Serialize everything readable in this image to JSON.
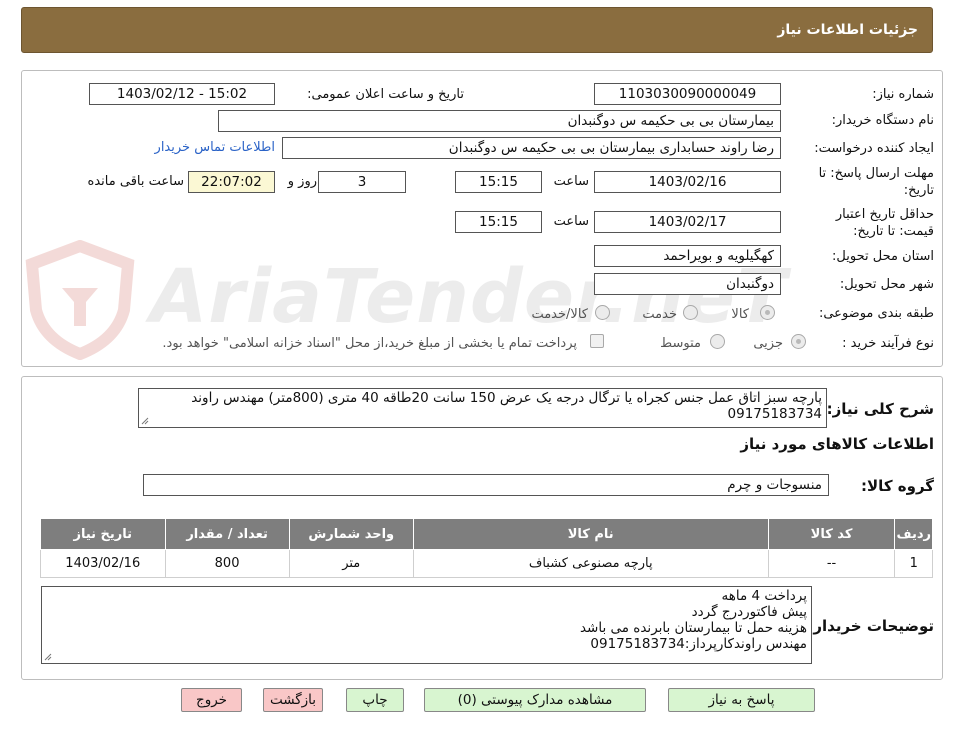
{
  "header": {
    "title": "جزئیات اطلاعات نیاز"
  },
  "form": {
    "need_number_label": "شماره نیاز:",
    "need_number": "1103030090000049",
    "announce_label": "تاریخ و ساعت اعلان عمومی:",
    "announce_value": "1403/02/12 - 15:02",
    "buyer_org_label": "نام دستگاه خریدار:",
    "buyer_org": "بیمارستان بی بی حکیمه س  دوگنبدان",
    "requester_label": "ایجاد کننده درخواست:",
    "requester": "رضا راوند حسابداری بیمارستان بی بی حکیمه س  دوگنبدان",
    "contact_link": "اطلاعات تماس خریدار",
    "deadline_label_1": "مهلت ارسال پاسخ: تا",
    "deadline_label_2": "تاریخ:",
    "deadline_date": "1403/02/16",
    "time_label": "ساعت",
    "deadline_time": "15:15",
    "days_value": "3",
    "days_label": "روز و",
    "remaining_time": "22:07:02",
    "remaining_label": "ساعت باقی مانده",
    "validity_label_1": "حداقل تاریخ اعتبار",
    "validity_label_2": "قیمت: تا تاریخ:",
    "validity_date": "1403/02/17",
    "validity_time": "15:15",
    "province_label": "استان محل تحویل:",
    "province": "کهگیلویه و بویراحمد",
    "city_label": "شهر محل تحویل:",
    "city": "دوگنبدان",
    "category_label": "طبقه بندی موضوعی:",
    "category_options": [
      "کالا",
      "خدمت",
      "کالا/خدمت"
    ],
    "process_label": "نوع فرآیند خرید :",
    "process_options": [
      "جزیی",
      "متوسط"
    ],
    "payment_note": "پرداخت تمام یا بخشی از مبلغ خرید،از محل \"اسناد خزانه اسلامی\" خواهد بود."
  },
  "description": {
    "label": "شرح کلی نیاز:",
    "text": "پارچه سبز اتاق عمل جنس کجراه یا ترگال درجه یک عرض 150 سانت 20طاقه 40 متری (800متر) مهندس راوند 09175183734",
    "goods_info_title": "اطلاعات کالاهای مورد نیاز",
    "goods_group_label": "گروه کالا:",
    "goods_group": "منسوجات و چرم"
  },
  "table": {
    "headers": [
      "ردیف",
      "کد کالا",
      "نام کالا",
      "واحد شمارش",
      "تعداد / مقدار",
      "تاریخ نیاز"
    ],
    "rows": [
      {
        "row": "1",
        "code": "--",
        "name": "پارچه مصنوعی کشباف",
        "unit": "متر",
        "qty": "800",
        "date": "1403/02/16"
      }
    ]
  },
  "buyer_notes": {
    "label": "توضیحات خریدار:",
    "lines": [
      "پرداخت 4 ماهه",
      "پیش فاکتوردرج گردد",
      "هزینه حمل تا بیمارستان بابرنده می باشد",
      "مهندس راوندکارپرداز:09175183734"
    ]
  },
  "buttons": {
    "reply": "پاسخ به نیاز",
    "attachments": "مشاهده مدارک پیوستی (0)",
    "print": "چاپ",
    "back": "بازگشت",
    "exit": "خروج"
  },
  "watermark": {
    "text": "AriaTender.neT"
  },
  "colors": {
    "header_bg": "#8a6d3f",
    "table_header": "#7e7e7e",
    "button_green": "#d8f5d0",
    "button_red": "#f9c7c7",
    "link": "#2b63c7"
  }
}
